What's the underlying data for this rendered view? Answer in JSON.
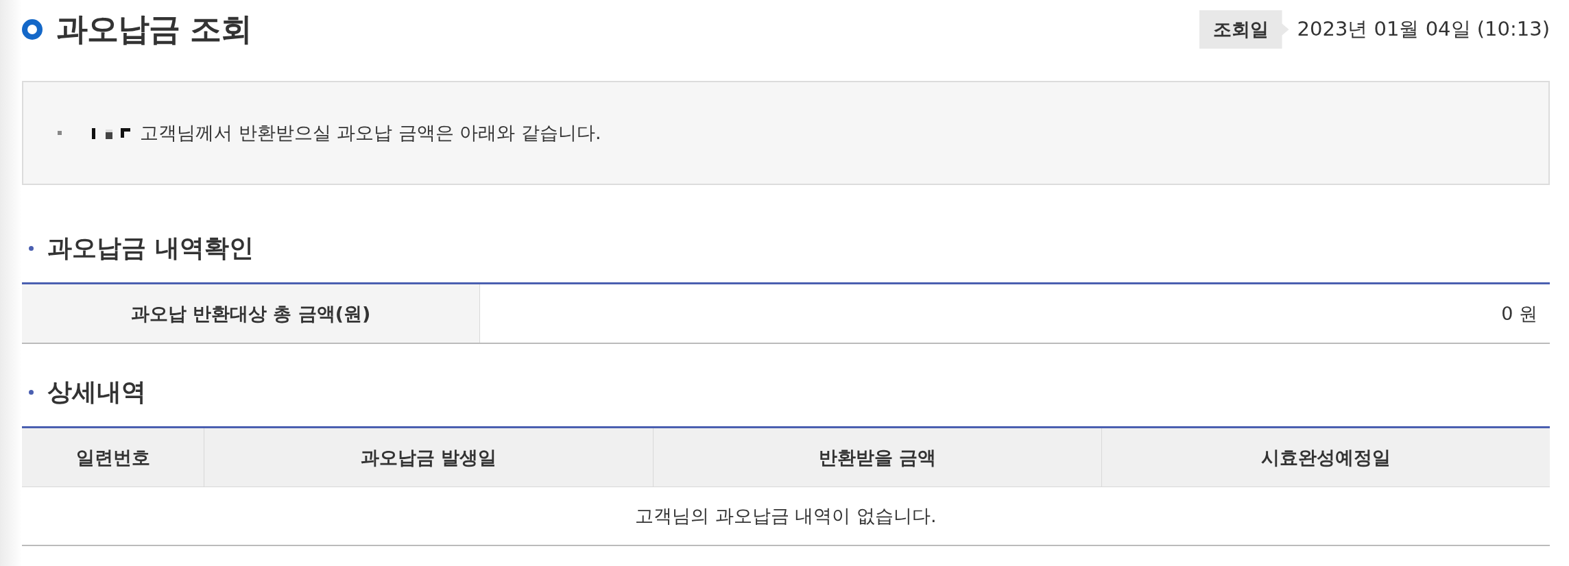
{
  "header": {
    "title": "과오납금 조회",
    "date_label": "조회일",
    "date_value": "2023년 01월 04일 (10:13)"
  },
  "notice": {
    "text": "고객님께서 반환받으실 과오납 금액은 아래와 같습니다."
  },
  "summary": {
    "title": "과오납금 내역확인",
    "label": "과오납 반환대상 총 금액(원)",
    "value": "0 원"
  },
  "details": {
    "title": "상세내역",
    "columns": [
      "일련번호",
      "과오납금 발생일",
      "반환받을 금액",
      "시효완성예정일"
    ],
    "empty_message": "고객님의 과오납금 내역이 없습니다."
  }
}
